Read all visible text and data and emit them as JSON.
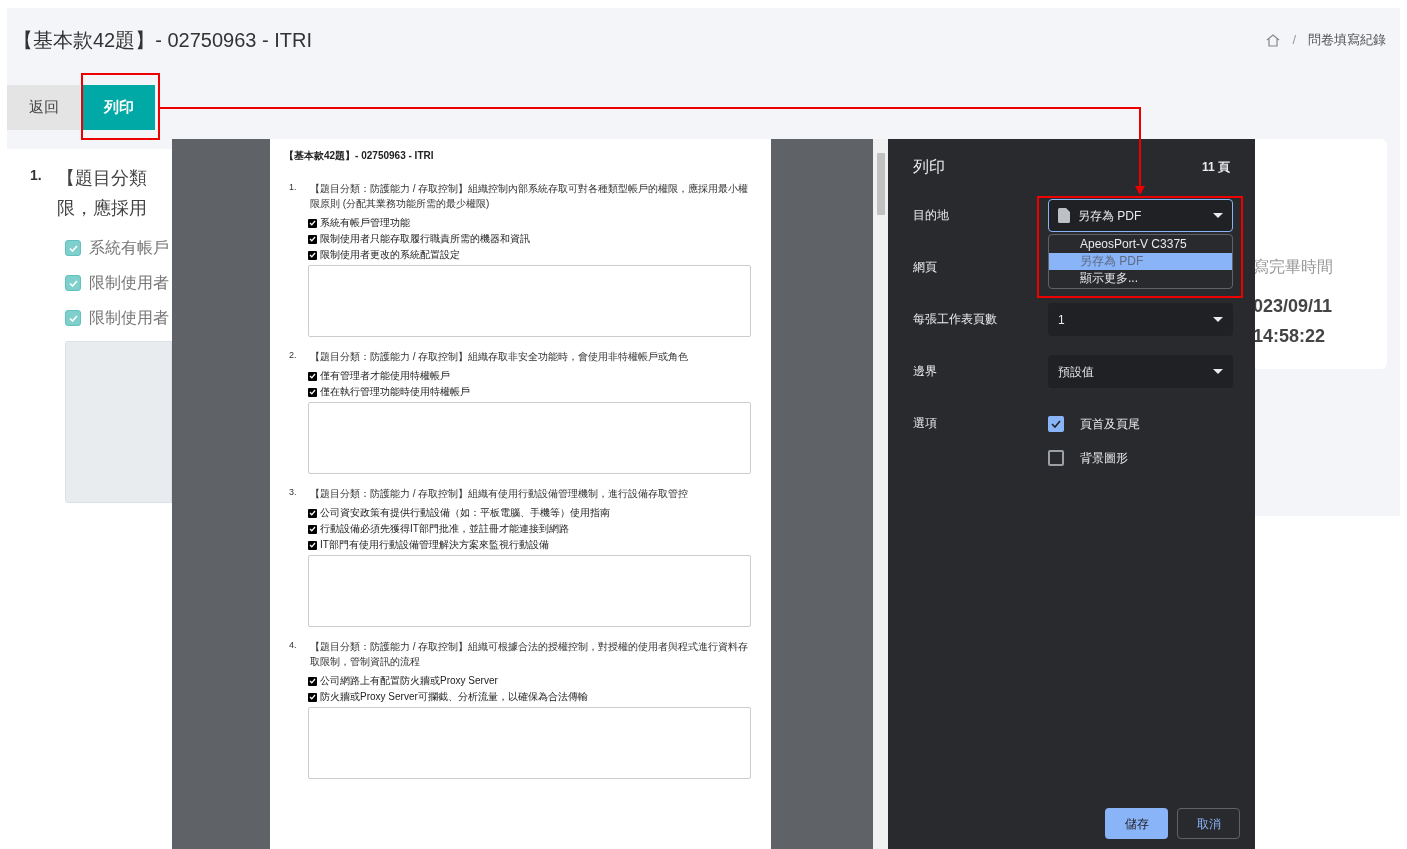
{
  "page": {
    "title": "【基本款42題】- 02750963 - ITRI",
    "breadcrumb_separator": "/",
    "breadcrumb": [
      "問卷填寫紀錄"
    ]
  },
  "actions": [
    {
      "label": "返回",
      "kind": "secondary"
    },
    {
      "label": "列印",
      "kind": "primary"
    }
  ],
  "question_card": {
    "number": "1.",
    "title_lines": [
      "【題目分類",
      "限，應採用"
    ],
    "options": [
      {
        "label": "系統有帳戶",
        "checked": true
      },
      {
        "label": "限制使用者",
        "checked": true
      },
      {
        "label": "限制使用者",
        "checked": true
      }
    ]
  },
  "info_card": {
    "label": "寫完畢時間",
    "value_lines": [
      "023/09/11",
      "14:58:22"
    ]
  },
  "print_dialog": {
    "preview": {
      "heading": "【基本款42題】- 02750963 - ITRI",
      "questions": [
        {
          "number": "1.",
          "text": "【題目分類：防護能力 / 存取控制】組織控制內部系統存取可對各種類型帳戶的權限，應採用最小權限原則 (分配其業務功能所需的最少權限)",
          "options": [
            {
              "label": "系統有帳戶管理功能",
              "checked": true
            },
            {
              "label": "限制使用者只能存取履行職責所需的機器和資訊",
              "checked": true
            },
            {
              "label": "限制使用者更改的系統配置設定",
              "checked": true
            }
          ]
        },
        {
          "number": "2.",
          "text": "【題目分類：防護能力 / 存取控制】組織存取非安全功能時，會使用非特權帳戶或角色",
          "options": [
            {
              "label": "僅有管理者才能使用特權帳戶",
              "checked": true
            },
            {
              "label": "僅在執行管理功能時使用特權帳戶",
              "checked": true
            }
          ]
        },
        {
          "number": "3.",
          "text": "【題目分類：防護能力 / 存取控制】組織有使用行動設備管理機制，進行設備存取管控",
          "options": [
            {
              "label": "公司資安政策有提供行動設備（如：平板電腦、手機等）使用指南",
              "checked": true
            },
            {
              "label": "行動設備必須先獲得IT部門批准，並註冊才能連接到網路",
              "checked": true
            },
            {
              "label": "IT部門有使用行動設備管理解決方案來監視行動設備",
              "checked": true
            }
          ]
        },
        {
          "number": "4.",
          "text": "【題目分類：防護能力 / 存取控制】組織可根據合法的授權控制，對授權的使用者與程式進行資料存取限制，管制資訊的流程",
          "options": [
            {
              "label": "公司網路上有配置防火牆或Proxy Server",
              "checked": true
            },
            {
              "label": "防火牆或Proxy Server可攔截、分析流量，以確保為合法傳輸",
              "checked": true
            }
          ]
        }
      ]
    },
    "title": "列印",
    "page_count": "11 頁",
    "settings": [
      {
        "kind": "destination",
        "label": "目的地",
        "value": "另存為 PDF",
        "expanded": true,
        "options": [
          {
            "label": "ApeosPort-V C3375",
            "selected": false
          },
          {
            "label": "另存為 PDF",
            "selected": true
          },
          {
            "label": "顯示更多...",
            "selected": false
          }
        ]
      },
      {
        "kind": "covered",
        "label": "網頁"
      },
      {
        "kind": "select",
        "label": "每張工作表頁數",
        "value": "1",
        "expanded": false
      },
      {
        "kind": "select",
        "label": "邊界",
        "value": "預設值",
        "expanded": false
      },
      {
        "kind": "checkboxes",
        "label": "選項",
        "options": [
          {
            "label": "頁首及頁尾",
            "checked": true
          },
          {
            "label": "背景圖形",
            "checked": false
          }
        ]
      }
    ],
    "buttons": [
      {
        "label": "儲存",
        "kind": "primary"
      },
      {
        "label": "取消",
        "kind": "secondary"
      }
    ]
  }
}
